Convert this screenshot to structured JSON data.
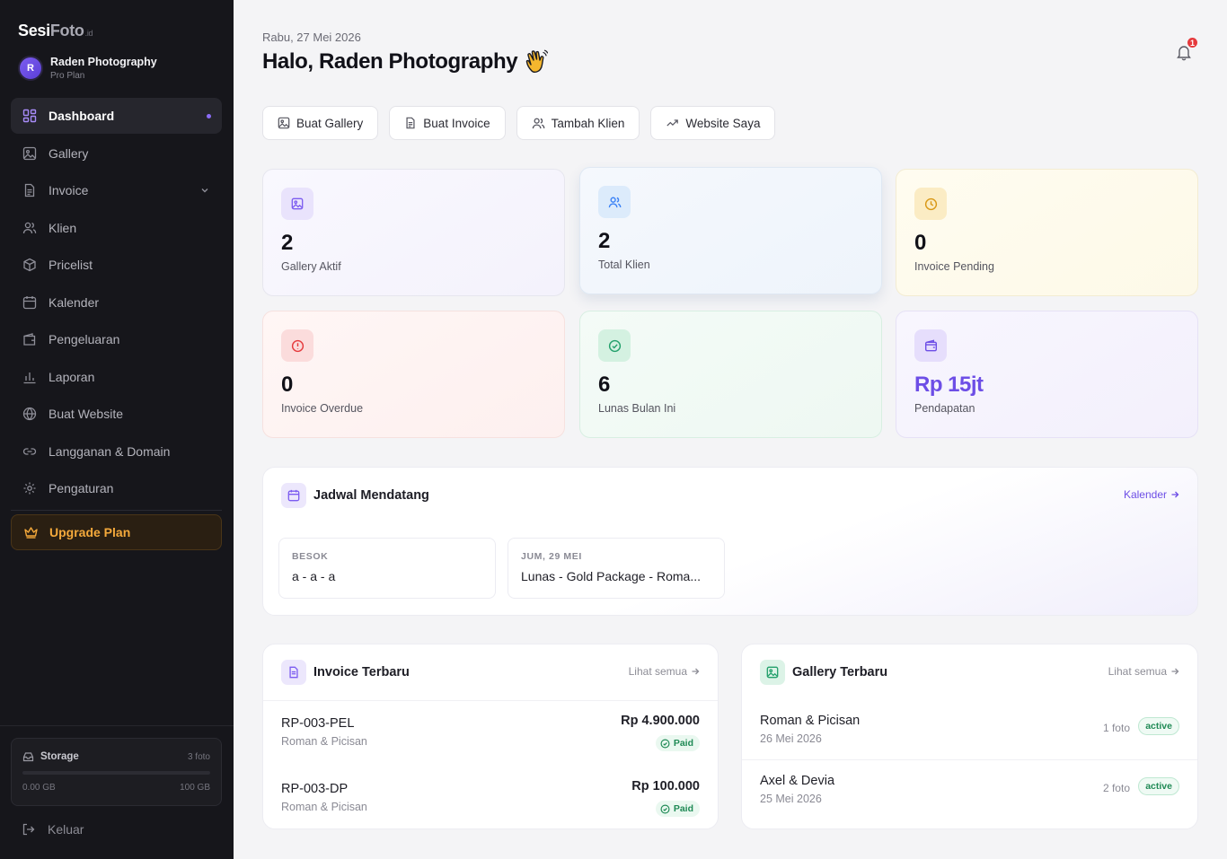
{
  "brand": {
    "part1": "Sesi",
    "part2": "Foto",
    "suffix": ".id"
  },
  "profile": {
    "initial": "R",
    "name": "Raden Photography",
    "plan": "Pro Plan"
  },
  "sidebar": {
    "items": [
      {
        "label": "Dashboard",
        "icon": "dashboard-icon"
      },
      {
        "label": "Gallery",
        "icon": "image-icon"
      },
      {
        "label": "Invoice",
        "icon": "document-icon"
      },
      {
        "label": "Klien",
        "icon": "users-icon"
      },
      {
        "label": "Pricelist",
        "icon": "box-icon"
      },
      {
        "label": "Kalender",
        "icon": "calendar-icon"
      },
      {
        "label": "Pengeluaran",
        "icon": "wallet-icon"
      },
      {
        "label": "Laporan",
        "icon": "bar-chart-icon"
      },
      {
        "label": "Buat Website",
        "icon": "globe-icon"
      },
      {
        "label": "Langganan & Domain",
        "icon": "link-icon"
      },
      {
        "label": "Pengaturan",
        "icon": "gear-icon"
      }
    ],
    "upgrade_label": "Upgrade Plan",
    "storage": {
      "label": "Storage",
      "files": "3 foto",
      "used": "0.00 GB",
      "total": "100 GB",
      "fill_fraction": 0
    },
    "logout_label": "Keluar"
  },
  "header": {
    "date": "Rabu, 27 Mei 2026",
    "greeting": "Halo, Raden Photography",
    "notification_count": "1"
  },
  "quick_actions": [
    {
      "label": "Buat Gallery",
      "icon": "image-icon"
    },
    {
      "label": "Buat Invoice",
      "icon": "document-icon"
    },
    {
      "label": "Tambah Klien",
      "icon": "users-icon"
    },
    {
      "label": "Website Saya",
      "icon": "trend-icon"
    }
  ],
  "stats": [
    {
      "value": "2",
      "label": "Gallery Aktif",
      "color": "#7c5cf0"
    },
    {
      "value": "2",
      "label": "Total Klien",
      "color": "#3b82f6"
    },
    {
      "value": "0",
      "label": "Invoice Pending",
      "color": "#e0a020"
    },
    {
      "value": "0",
      "label": "Invoice Overdue",
      "color": "#e5393c"
    },
    {
      "value": "6",
      "label": "Lunas Bulan Ini",
      "color": "#22a06b"
    },
    {
      "value": "Rp 15jt",
      "label": "Pendapatan",
      "color": "#6d4ee6"
    }
  ],
  "schedule": {
    "title": "Jadwal Mendatang",
    "link": "Kalender",
    "events": [
      {
        "day": "BESOK",
        "title": "a - a - a"
      },
      {
        "day": "JUM, 29 MEI",
        "title": "Lunas - Gold Package - Roma..."
      }
    ]
  },
  "invoices": {
    "title": "Invoice Terbaru",
    "link": "Lihat semua",
    "rows": [
      {
        "id": "RP-003-PEL",
        "client": "Roman & Picisan",
        "amount": "Rp 4.900.000",
        "status": "Paid"
      },
      {
        "id": "RP-003-DP",
        "client": "Roman & Picisan",
        "amount": "Rp 100.000",
        "status": "Paid"
      }
    ]
  },
  "galleries": {
    "title": "Gallery Terbaru",
    "link": "Lihat semua",
    "rows": [
      {
        "name": "Roman & Picisan",
        "date": "26 Mei 2026",
        "count": "1 foto",
        "status": "active"
      },
      {
        "name": "Axel & Devia",
        "date": "25 Mei 2026",
        "count": "2 foto",
        "status": "active"
      }
    ]
  }
}
